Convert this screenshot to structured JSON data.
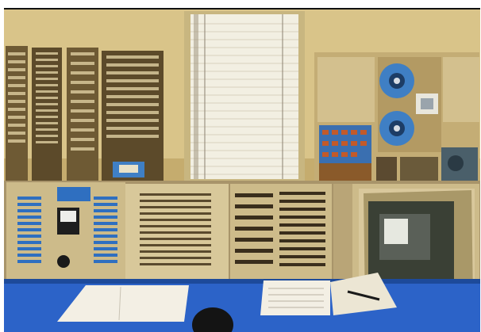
{
  "photo": {
    "subject": "vintage-computer-room",
    "palette": {
      "wall": "#d9c489",
      "wall_shadow": "#b79d5c",
      "rack": "#5c4a2a",
      "rack_light": "#c9b07a",
      "window": "#f2efe2",
      "console": "#cdbb8a",
      "console_dark": "#a8946a",
      "panel_blue": "#2f6fc0",
      "desk": "#2c63c8",
      "desk_dark": "#1d4a9a",
      "paper": "#f3efe4",
      "screen": "#3a4035",
      "screen_glow": "#e6e8e0",
      "tape_reel": "#3f7fc4",
      "frame": "#111111"
    }
  }
}
